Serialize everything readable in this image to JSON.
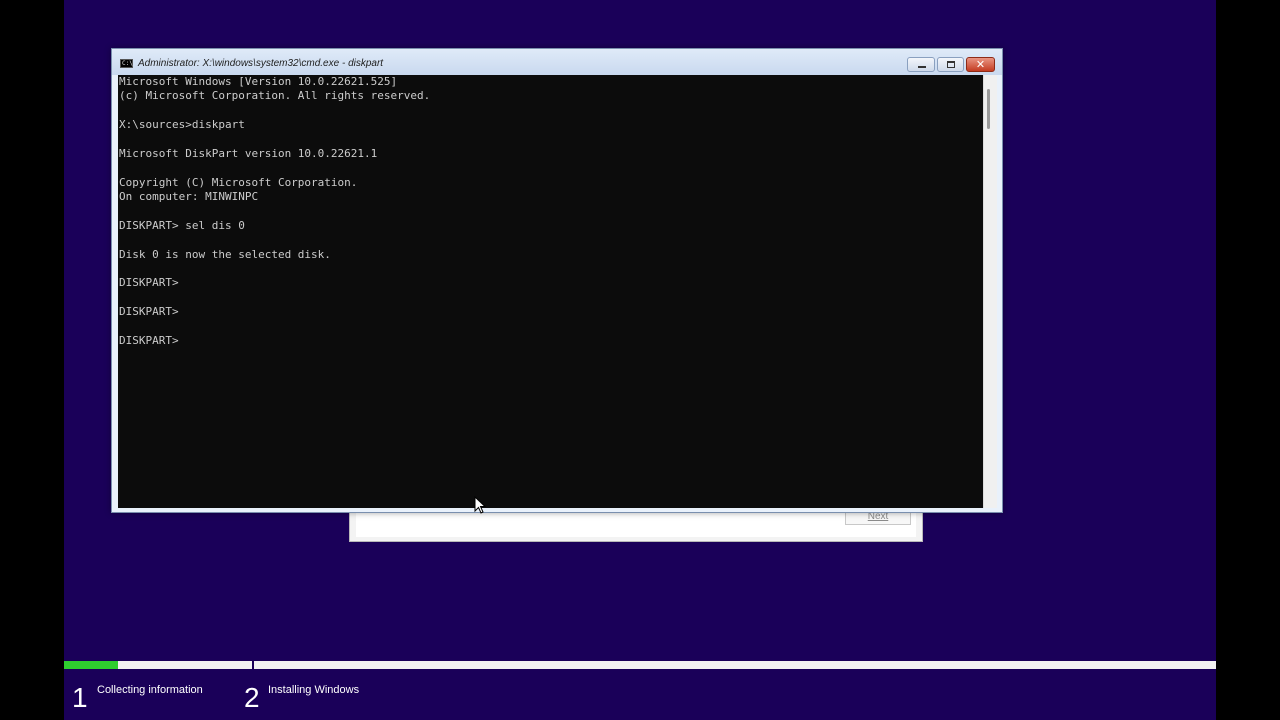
{
  "setup": {
    "next_label": "Next"
  },
  "cmd_window": {
    "title": "Administrator: X:\\windows\\system32\\cmd.exe - diskpart",
    "icon_label": "C:\\",
    "close_glyph": "✕",
    "lines": [
      "Microsoft Windows [Version 10.0.22621.525]",
      "(c) Microsoft Corporation. All rights reserved.",
      "",
      "X:\\sources>diskpart",
      "",
      "Microsoft DiskPart version 10.0.22621.1",
      "",
      "Copyright (C) Microsoft Corporation.",
      "On computer: MINWINPC",
      "",
      "DISKPART> sel dis 0",
      "",
      "Disk 0 is now the selected disk.",
      "",
      "DISKPART>",
      "",
      "DISKPART>",
      "",
      "DISKPART>"
    ]
  },
  "progress": {
    "fraction": 0.047
  },
  "steps": [
    {
      "number": "1",
      "label": "Collecting information"
    },
    {
      "number": "2",
      "label": "Installing Windows"
    }
  ],
  "colors": {
    "background": "#1a0059",
    "progress_fill": "#2fcf2f",
    "console_bg": "#0c0c0c",
    "console_text": "#cccccc"
  },
  "icons": [
    "console-icon",
    "minimize-icon",
    "maximize-icon",
    "close-icon",
    "mouse-pointer-icon"
  ]
}
